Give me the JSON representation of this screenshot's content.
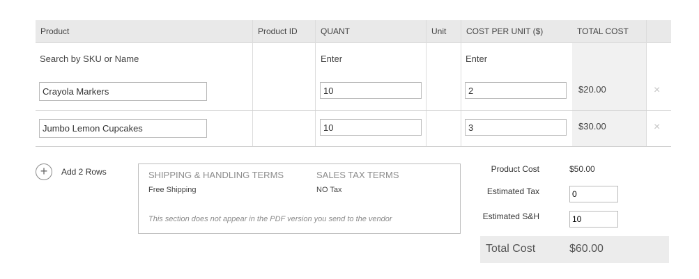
{
  "table": {
    "headers": {
      "product": "Product",
      "product_id": "Product ID",
      "quant": "QUANT",
      "unit": "Unit",
      "cost_per_unit": "COST PER UNIT ($)",
      "total_cost": "TOTAL COST"
    },
    "search_label": "Search by SKU or Name",
    "quant_enter": "Enter",
    "cost_enter": "Enter",
    "rows": [
      {
        "product": "Crayola Markers",
        "quantity": "10",
        "cost": "2",
        "total": "$20.00"
      },
      {
        "product": "Jumbo Lemon Cupcakes",
        "quantity": "10",
        "cost": "3",
        "total": "$30.00"
      }
    ],
    "remove_glyph": "×"
  },
  "add_rows": {
    "icon": "+",
    "label": "Add 2 Rows"
  },
  "terms": {
    "shipping_title": "SHIPPING & HANDLING TERMS",
    "shipping_value": "Free Shipping",
    "tax_title": "SALES TAX TERMS",
    "tax_value": "NO Tax",
    "note": "This section does not appear in the PDF version you send to the vendor"
  },
  "summary": {
    "product_cost_label": "Product Cost",
    "product_cost_value": "$50.00",
    "estimated_tax_label": "Estimated Tax",
    "estimated_tax_value": "0",
    "estimated_sh_label": "Estimated S&H",
    "estimated_sh_value": "10",
    "total_label": "Total Cost",
    "total_value": "$60.00"
  }
}
